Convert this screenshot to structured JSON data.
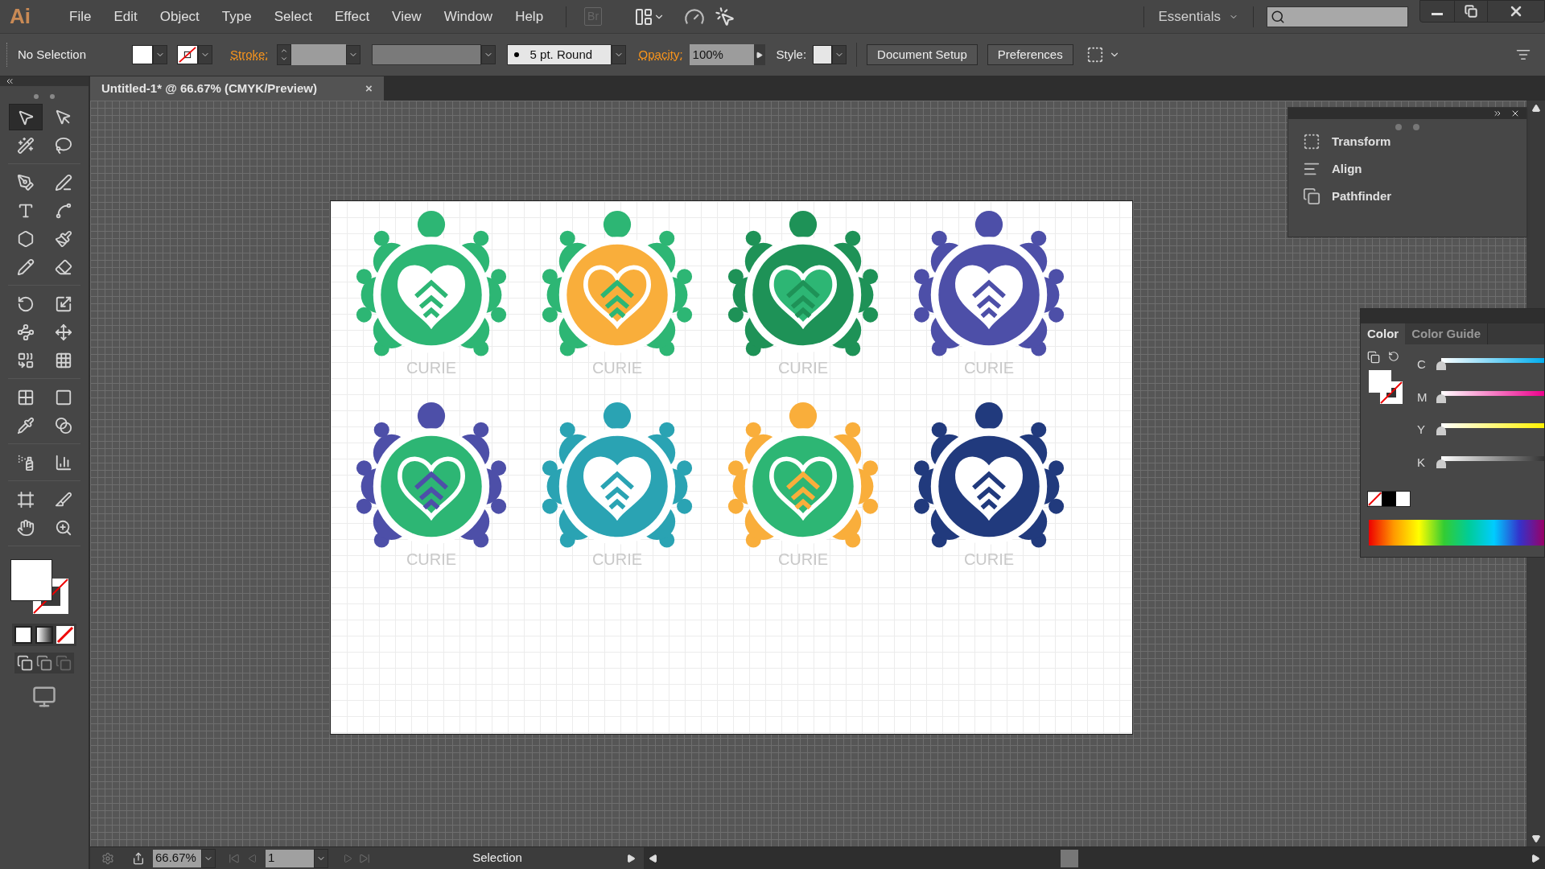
{
  "app_logo": "Ai",
  "menu": [
    "File",
    "Edit",
    "Object",
    "Type",
    "Select",
    "Effect",
    "View",
    "Window",
    "Help"
  ],
  "bridge_badge": "Br",
  "workspace": "Essentials",
  "control_bar": {
    "selection": "No Selection",
    "stroke_label": "Stroke:",
    "brush": "5 pt. Round",
    "opacity_label": "Opacity:",
    "opacity": "100%",
    "style_label": "Style:",
    "buttons": [
      "Document Setup",
      "Preferences"
    ]
  },
  "document_tab": {
    "title": "Untitled-1* @ 66.67% (CMYK/Preview)",
    "close": "×",
    "selected": true
  },
  "toolbar": {
    "groups": [
      {
        "tools": [
          {
            "kind": "selection",
            "selected": true
          },
          {
            "kind": "direct",
            "selected": false
          },
          {
            "kind": "wand",
            "selected": false
          },
          {
            "kind": "lasso",
            "selected": false
          }
        ]
      },
      {
        "tools": [
          {
            "kind": "pen",
            "selected": false
          },
          {
            "kind": "curvature",
            "selected": false
          },
          {
            "kind": "type",
            "selected": false
          },
          {
            "kind": "arc",
            "selected": false
          },
          {
            "kind": "polygon",
            "selected": false
          },
          {
            "kind": "brush",
            "selected": false
          },
          {
            "kind": "pencil",
            "selected": false
          },
          {
            "kind": "eraser",
            "selected": false
          }
        ]
      },
      {
        "tools": [
          {
            "kind": "rotate",
            "selected": false
          },
          {
            "kind": "scale",
            "selected": false
          },
          {
            "kind": "warp",
            "selected": false
          },
          {
            "kind": "transform",
            "selected": false
          },
          {
            "kind": "builder",
            "selected": false
          },
          {
            "kind": "perspective",
            "selected": false
          }
        ]
      },
      {
        "tools": [
          {
            "kind": "mesh",
            "selected": false
          },
          {
            "kind": "gradient",
            "selected": false
          },
          {
            "kind": "eyedropper",
            "selected": false
          },
          {
            "kind": "blend",
            "selected": false
          }
        ]
      },
      {
        "tools": [
          {
            "kind": "spray",
            "selected": false
          },
          {
            "kind": "graph",
            "selected": false
          }
        ]
      },
      {
        "tools": [
          {
            "kind": "artboard",
            "selected": false
          },
          {
            "kind": "slice",
            "selected": false
          },
          {
            "kind": "hand",
            "selected": false
          },
          {
            "kind": "zoom",
            "selected": false
          }
        ]
      }
    ]
  },
  "logos": [
    {
      "label": "CURIE",
      "parts": [
        {
          "kind": "body",
          "color": "#2db674"
        },
        {
          "kind": "ring",
          "color": "#2db674"
        },
        {
          "kind": "heart",
          "color": "#ffffff"
        }
      ]
    },
    {
      "label": "CURIE",
      "parts": [
        {
          "kind": "body",
          "color": "#2db674"
        },
        {
          "kind": "ring",
          "color": "#f9ae3b"
        },
        {
          "kind": "heart",
          "color": "#f9ae3b"
        }
      ]
    },
    {
      "label": "CURIE",
      "parts": [
        {
          "kind": "body",
          "color": "#1e9257"
        },
        {
          "kind": "ring",
          "color": "#1e9257"
        },
        {
          "kind": "heart",
          "color": "#2db674"
        }
      ]
    },
    {
      "label": "CURIE",
      "parts": [
        {
          "kind": "body",
          "color": "#4d4fa8"
        },
        {
          "kind": "ring",
          "color": "#4d4fa8"
        },
        {
          "kind": "heart",
          "color": "#ffffff"
        }
      ]
    },
    {
      "label": "CURIE",
      "parts": [
        {
          "kind": "body",
          "color": "#4d4fa8"
        },
        {
          "kind": "ring",
          "color": "#2db674"
        },
        {
          "kind": "heart",
          "color": "#2db674"
        }
      ]
    },
    {
      "label": "CURIE",
      "parts": [
        {
          "kind": "body",
          "color": "#2aa3b3"
        },
        {
          "kind": "ring",
          "color": "#2aa3b3"
        },
        {
          "kind": "heart",
          "color": "#ffffff"
        }
      ]
    },
    {
      "label": "CURIE",
      "parts": [
        {
          "kind": "body",
          "color": "#f9ae3b"
        },
        {
          "kind": "ring",
          "color": "#2db674"
        },
        {
          "kind": "heart",
          "color": "#2db674"
        }
      ]
    },
    {
      "label": "CURIE",
      "parts": [
        {
          "kind": "body",
          "color": "#213a7d"
        },
        {
          "kind": "ring",
          "color": "#213a7d"
        },
        {
          "kind": "heart",
          "color": "#ffffff"
        }
      ]
    }
  ],
  "panel": {
    "items": [
      {
        "kind": "transform",
        "label": "Transform"
      },
      {
        "kind": "align",
        "label": "Align"
      },
      {
        "kind": "pathfinder",
        "label": "Pathfinder"
      }
    ]
  },
  "color_panel": {
    "tabs": [
      {
        "label": "Color",
        "selected": true
      },
      {
        "label": "Color Guide",
        "selected": false
      }
    ],
    "sliders": [
      {
        "label": "C",
        "level": 0
      },
      {
        "label": "M",
        "level": 0
      },
      {
        "label": "Y",
        "level": 0
      },
      {
        "label": "K",
        "level": 0
      }
    ]
  },
  "status_bar": {
    "zoom": "66.67%",
    "artboard": "1",
    "tool": "Selection"
  }
}
